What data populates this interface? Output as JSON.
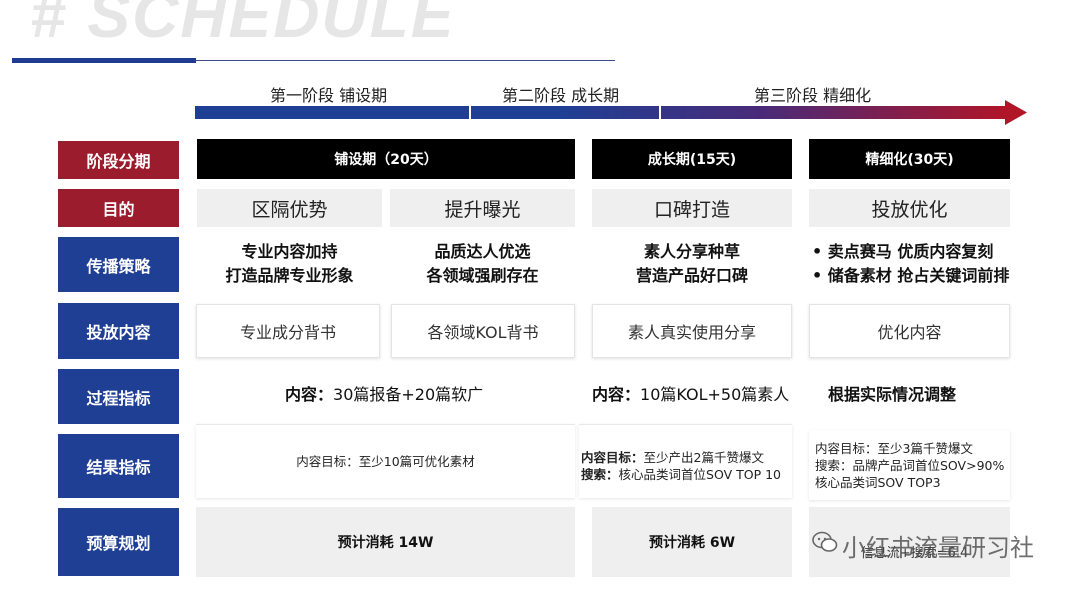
{
  "header": {
    "title": "# SCHEDULE"
  },
  "phases": [
    {
      "label": "第一阶段 铺设期"
    },
    {
      "label": "第二阶段 成长期"
    },
    {
      "label": "第三阶段 精细化"
    }
  ],
  "row_headers": {
    "stage": "阶段分期",
    "goal": "目的",
    "strategy": "传播策略",
    "content": "投放内容",
    "process": "过程指标",
    "result": "结果指标",
    "budget": "预算规划"
  },
  "stages": {
    "s1": "铺设期（20天）",
    "s2": "成长期(15天)",
    "s3": "精细化(30天)"
  },
  "goals": [
    "区隔优势",
    "提升曝光",
    "口碑打造",
    "投放优化"
  ],
  "strategy": {
    "c1": [
      "专业内容加持",
      "打造品牌专业形象"
    ],
    "c2": [
      "品质达人优选",
      "各领域强刷存在"
    ],
    "c3": [
      "素人分享种草",
      "营造产品好口碑"
    ],
    "c4": [
      "• 卖点赛马 优质内容复刻",
      "• 储备素材 抢占关键词前排"
    ]
  },
  "content_items": [
    "专业成分背书",
    "各领域KOL背书",
    "素人真实使用分享",
    "优化内容"
  ],
  "process": {
    "p1_label": "内容：",
    "p1_value": "30篇报备+20篇软广",
    "p2_label": "内容：",
    "p2_value": "10篇KOL+50篇素人",
    "p3": "根据实际情况调整"
  },
  "results": {
    "r1": "内容目标：至少10篇可优化素材",
    "r2_l1_label": "内容目标：",
    "r2_l1_value": "至少产出2篇千赞爆文",
    "r2_l2_label": "搜索：",
    "r2_l2_value": "核心品类词首位SOV TOP 10",
    "r3_l1": "内容目标：至少3篇千赞爆文",
    "r3_l2": "搜索：品牌产品词首位SOV>90%",
    "r3_l3": "核心品类词SOV TOP3"
  },
  "budget": {
    "b1": "预计消耗 14W",
    "b2": "预计消耗 6W",
    "b3_partial": "信息流+搜索=6.4"
  },
  "watermark": "小红书流量研习社",
  "colors": {
    "blue": "#1f3f95",
    "red": "#9b1c2c",
    "black": "#000000",
    "light_gray": "#efefef"
  }
}
